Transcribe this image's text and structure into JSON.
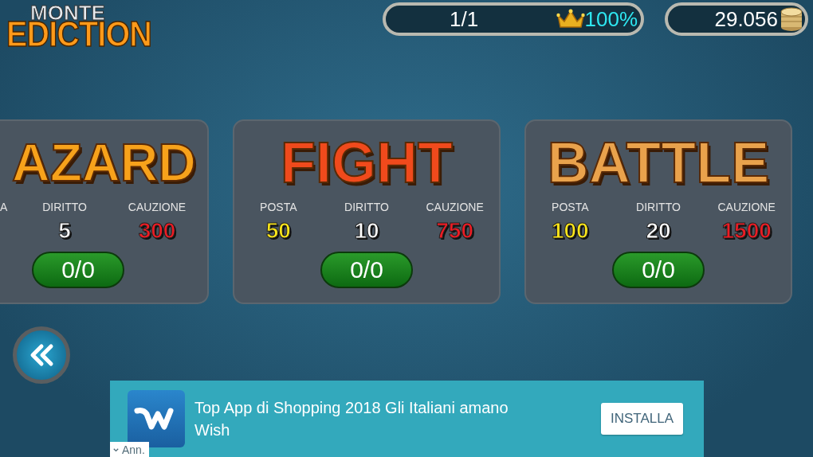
{
  "logo": {
    "top": "MONTE",
    "bottom": "EDICTION"
  },
  "status": {
    "progress": "1/1",
    "percent": "100%",
    "coins": "29.056"
  },
  "rooms": [
    {
      "kind": "partial",
      "title": "AZARD",
      "color": "#f7a21b",
      "stats": [
        {
          "kind": "posta",
          "label": "A"
        },
        {
          "kind": "diritto",
          "label": "DIRITTO",
          "value": "5"
        },
        {
          "kind": "cauzione",
          "label": "CAUZIONE",
          "value": "300"
        }
      ],
      "players": "0/0"
    },
    {
      "kind": "full",
      "title": "FIGHT",
      "color": "#f04a1c",
      "stats": [
        {
          "kind": "posta",
          "label": "POSTA",
          "value": "50"
        },
        {
          "kind": "diritto",
          "label": "DIRITTO",
          "value": "10"
        },
        {
          "kind": "cauzione",
          "label": "CAUZIONE",
          "value": "750"
        }
      ],
      "players": "0/0"
    },
    {
      "kind": "full",
      "title": "BATTLE",
      "color": "#e9a24c",
      "stats": [
        {
          "kind": "posta",
          "label": "POSTA",
          "value": "100"
        },
        {
          "kind": "diritto",
          "label": "DIRITTO",
          "value": "20"
        },
        {
          "kind": "cauzione",
          "label": "CAUZIONE",
          "value": "1500"
        }
      ],
      "players": "0/0"
    }
  ],
  "ad": {
    "text": "Top App di Shopping 2018 Gli Italiani amano Wish",
    "button": "INSTALLA",
    "tag": "Ann."
  }
}
